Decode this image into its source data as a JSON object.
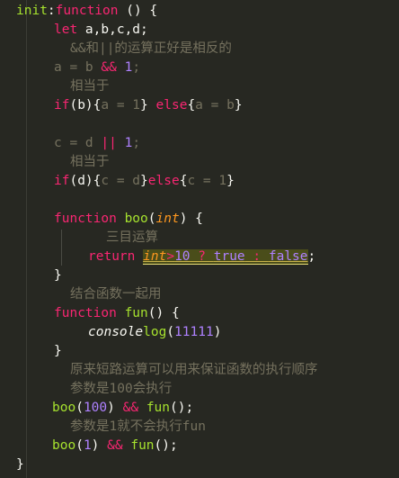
{
  "code": {
    "l1": {
      "a": "init",
      "b": ":",
      "c": "function",
      "d": " () {"
    },
    "l2": {
      "a": "let",
      "b": " a,b,c,d;"
    },
    "l3": {
      "a": "&&和||的运算正好是相反的"
    },
    "l4": {
      "a": "a = b ",
      "b": "&&",
      "c": " ",
      "d": "1",
      ";": ";"
    },
    "l5": {
      "a": "相当于"
    },
    "l6": {
      "a": "if",
      "b": "(b){",
      "c": "a = 1",
      "d": "} ",
      "e": "else",
      "f": "{",
      "g": "a = b",
      "h": "}"
    },
    "l7": {
      "a": "c = d ",
      "b": "||",
      "c": " ",
      "d": "1",
      ";": ";"
    },
    "l8": {
      "a": "相当于"
    },
    "l9": {
      "a": "if",
      "b": "(d){",
      "c": "c = d",
      "d": "}",
      "e": "else",
      "f": "{",
      "g": "c = 1",
      "h": "}"
    },
    "l10": {
      "a": "function",
      "b": " ",
      "c": "boo",
      "d": "(",
      "e": "int",
      "f": ") {"
    },
    "l11": {
      "a": "三目运算"
    },
    "l12": {
      "a": "return",
      "b": " ",
      "c": "int",
      "d": ">",
      "e": "10",
      "f": " ? ",
      "g": "true",
      "h": " : ",
      "i": "false",
      ";": ";"
    },
    "l13": {
      "a": "}"
    },
    "l14": {
      "a": "结合函数一起用"
    },
    "l15": {
      "a": "function",
      "b": " ",
      "c": "fun",
      "d": "() {"
    },
    "l16": {
      "a": "console",
      ".": ".",
      "b": "log",
      "c": "(",
      "d": "11111",
      "e": ")"
    },
    "l17": {
      "a": "}"
    },
    "l18": {
      "a": "原来短路运算可以用来保证函数的执行顺序"
    },
    "l19": {
      "a": "参数是100会执行"
    },
    "l20": {
      "a": "boo",
      "b": "(",
      "c": "100",
      "d": ") ",
      "e": "&&",
      "f": " ",
      "g": "fun",
      "h": "();"
    },
    "l21": {
      "a": "参数是1就不会执行fun"
    },
    "l22": {
      "a": "boo",
      "b": "(",
      "c": "1",
      "d": ") ",
      "e": "&&",
      "f": " ",
      "g": "fun",
      "h": "();"
    },
    "l23": {
      "a": "}"
    }
  }
}
